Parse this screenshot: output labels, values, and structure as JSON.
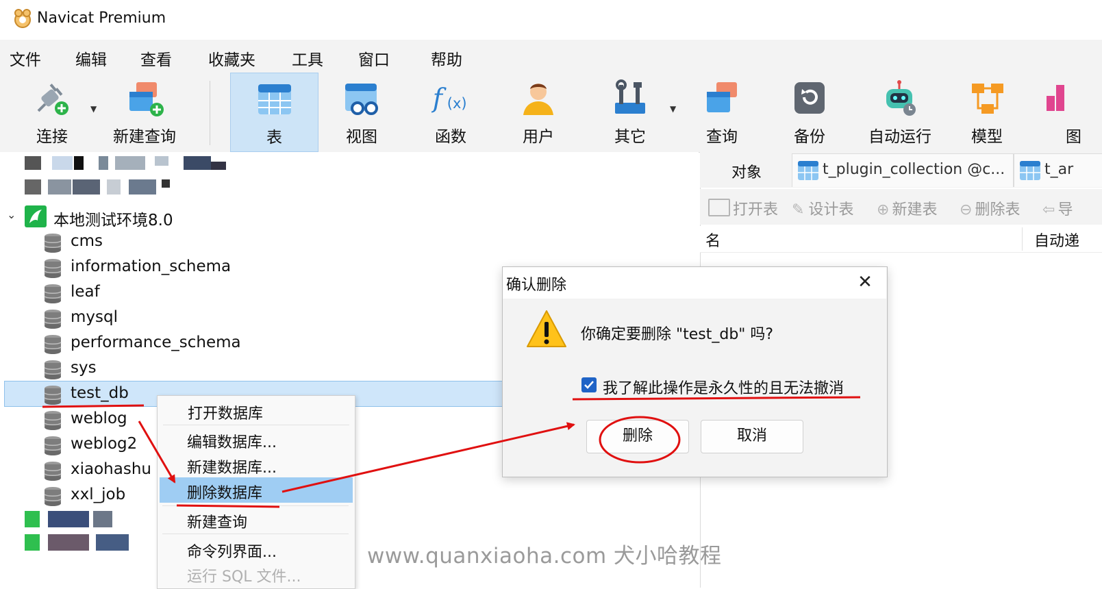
{
  "app": {
    "title": "Navicat Premium",
    "logo_icon": "navicat-logo-icon"
  },
  "menu": [
    "文件",
    "编辑",
    "查看",
    "收藏夹",
    "工具",
    "窗口",
    "帮助"
  ],
  "toolbar": {
    "connect": "连接",
    "new_query": "新建查询",
    "table": "表",
    "view": "视图",
    "function": "函数",
    "user": "用户",
    "other": "其它",
    "query": "查询",
    "backup": "备份",
    "automation": "自动运行",
    "model": "模型",
    "chart": "图"
  },
  "tree": {
    "connection": "本地测试环境8.0",
    "databases": [
      "cms",
      "information_schema",
      "leaf",
      "mysql",
      "performance_schema",
      "sys",
      "test_db",
      "weblog",
      "weblog2",
      "xiaohashu",
      "xxl_job"
    ],
    "selected": "test_db"
  },
  "right_panel": {
    "objects_tab": "对象",
    "tab1": "t_plugin_collection @c...",
    "tab2": "t_ar",
    "toolbar": {
      "open_table": "打开表",
      "design_table": "设计表",
      "new_table": "新建表",
      "delete_table": "删除表",
      "import": "导"
    },
    "columns": {
      "name": "名",
      "auto": "自动递"
    }
  },
  "context_menu": {
    "items": [
      "打开数据库",
      "编辑数据库...",
      "新建数据库...",
      "删除数据库",
      "新建查询",
      "命令列界面...",
      "运行 SQL 文件..."
    ],
    "highlighted": "删除数据库"
  },
  "dialog": {
    "title": "确认删除",
    "message": "你确定要删除 \"test_db\" 吗?",
    "checkbox_label": "我了解此操作是永久性的且无法撤消",
    "checkbox_checked": true,
    "delete_button": "删除",
    "cancel_button": "取消"
  },
  "watermark": "www.quanxiaoha.com 犬小哈教程",
  "colors": {
    "accent": "#1f63c6",
    "selection": "#cfe6fa",
    "menu_highlight": "#9fcdf3",
    "annotation": "#e01010"
  }
}
